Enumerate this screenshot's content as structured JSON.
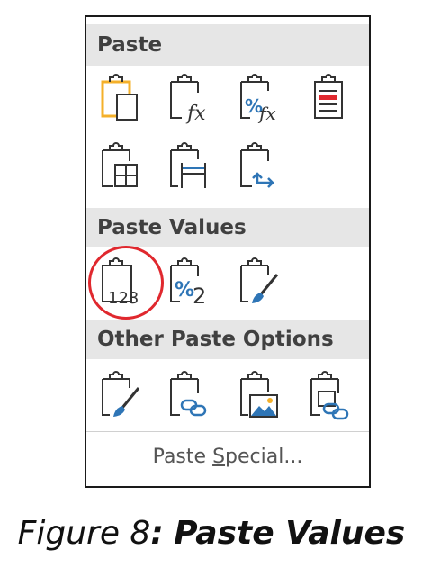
{
  "menu": {
    "paste": {
      "header": "Paste",
      "icons": [
        "paste-icon",
        "formulas-icon",
        "formulas-number-formatting-icon",
        "keep-source-formatting-icon",
        "no-borders-icon",
        "keep-source-column-widths-icon",
        "transpose-icon"
      ]
    },
    "paste_values": {
      "header": "Paste Values",
      "icons": [
        "values-icon",
        "values-number-formatting-icon",
        "values-source-formatting-icon"
      ],
      "values_text": "123",
      "percent_text": "%",
      "two_text": "2"
    },
    "other": {
      "header": "Other Paste Options",
      "icons": [
        "formatting-icon",
        "paste-link-icon",
        "picture-icon",
        "linked-picture-icon"
      ]
    },
    "paste_special": {
      "pre": "Paste ",
      "underlined": "S",
      "post": "pecial..."
    },
    "fx_text": "fx",
    "pct_fx_text": "%",
    "highlight_color": "#e0282e",
    "accent_blue": "#2e75b6",
    "accent_orange": "#f4b02a"
  },
  "caption": {
    "prefix": "Figure 8",
    "colon": ":",
    "title": "Paste Values"
  }
}
